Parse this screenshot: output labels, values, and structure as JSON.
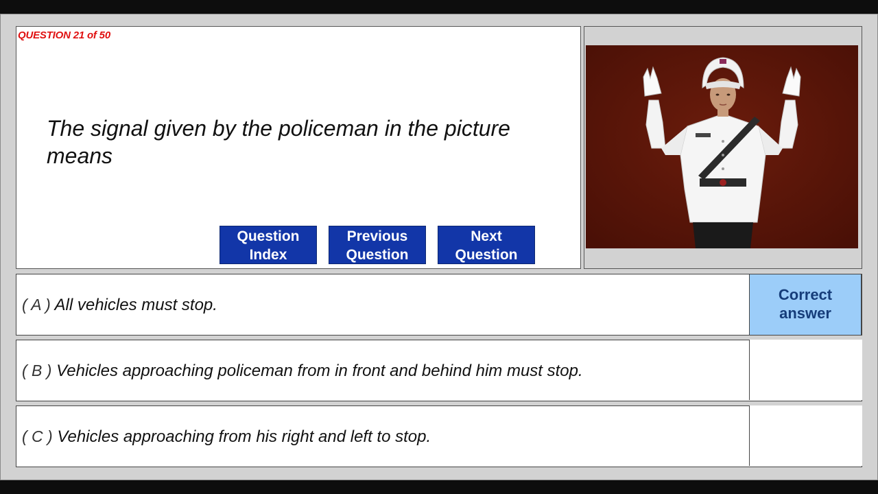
{
  "question": {
    "number_label": "QUESTION 21 of 50",
    "text": "The signal given by the policeman in the picture means"
  },
  "nav": {
    "index": [
      "Question",
      "Index"
    ],
    "previous": [
      "Previous",
      "Question"
    ],
    "next": [
      "Next",
      "Question"
    ]
  },
  "answers": [
    {
      "prefix": "( A )",
      "text": "All vehicles must stop.",
      "marked_correct": true
    },
    {
      "prefix": "( B )",
      "text": "Vehicles approaching policeman from in front and behind him must stop.",
      "marked_correct": false
    },
    {
      "prefix": "( C )",
      "text": "Vehicles approaching from his right and left to stop.",
      "marked_correct": false
    }
  ],
  "correct_label": [
    "Correct",
    "answer"
  ],
  "image": {
    "subject": "policeman-signal-illustration",
    "background_color": "#5a1509"
  },
  "colors": {
    "question_number": "#e01010",
    "nav_button": "#1236a8",
    "correct_highlight": "#9ccdf9"
  }
}
